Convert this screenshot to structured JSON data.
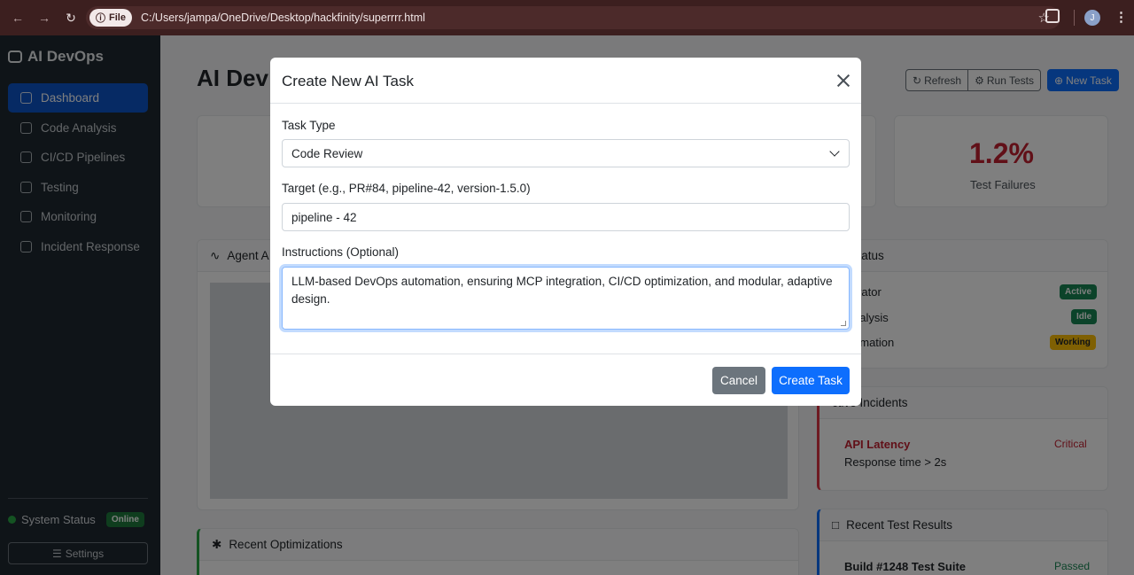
{
  "browser": {
    "file_label": "File",
    "url": "C:/Users/jampa/OneDrive/Desktop/hackfinity/superrrr.html",
    "profile_initial": "J"
  },
  "sidebar": {
    "brand": "AI DevOps",
    "items": [
      {
        "label": "Dashboard",
        "icon": "gauge-icon"
      },
      {
        "label": "Code Analysis",
        "icon": "code-icon"
      },
      {
        "label": "CI/CD Pipelines",
        "icon": "gear-icon"
      },
      {
        "label": "Testing",
        "icon": "bug-icon"
      },
      {
        "label": "Monitoring",
        "icon": "graph-icon"
      },
      {
        "label": "Incident Response",
        "icon": "lightning-icon"
      }
    ],
    "system_status_label": "System Status",
    "system_status_value": "Online",
    "settings_label": "Settings"
  },
  "main": {
    "title_partial": "AI Dev",
    "toolbar": {
      "refresh": "Refresh",
      "run_tests": "Run Tests",
      "new_task": "New Task"
    },
    "stat_value": "1.2%",
    "stat_label": "Test Failures",
    "agent_activity_partial": "Agent A",
    "agent_status": {
      "title_partial": "ent Status",
      "agents": [
        {
          "name_partial": "chestrator",
          "status": "Active"
        },
        {
          "name_partial": "de Analysis",
          "status": "Idle"
        },
        {
          "name_partial": "t Automation",
          "status": "Working"
        }
      ]
    },
    "incidents": {
      "title_partial": "ctive Incidents",
      "item_title": "API Latency",
      "item_severity": "Critical",
      "item_desc": "Response time > 2s"
    },
    "recent_tests": {
      "title": "Recent Test Results",
      "item_title": "Build #1248 Test Suite",
      "item_status": "Passed"
    },
    "recent_optimizations": "Recent Optimizations"
  },
  "modal": {
    "title": "Create New AI Task",
    "task_type_label": "Task Type",
    "task_type_value": "Code Review",
    "target_label": "Target (e.g., PR#84, pipeline-42, version-1.5.0)",
    "target_value": "pipeline - 42",
    "instructions_label": "Instructions (Optional)",
    "instructions_value": "LLM-based DevOps automation, ensuring MCP integration, CI/CD optimization, and modular, adaptive design.",
    "cancel_label": "Cancel",
    "create_label": "Create Task"
  }
}
